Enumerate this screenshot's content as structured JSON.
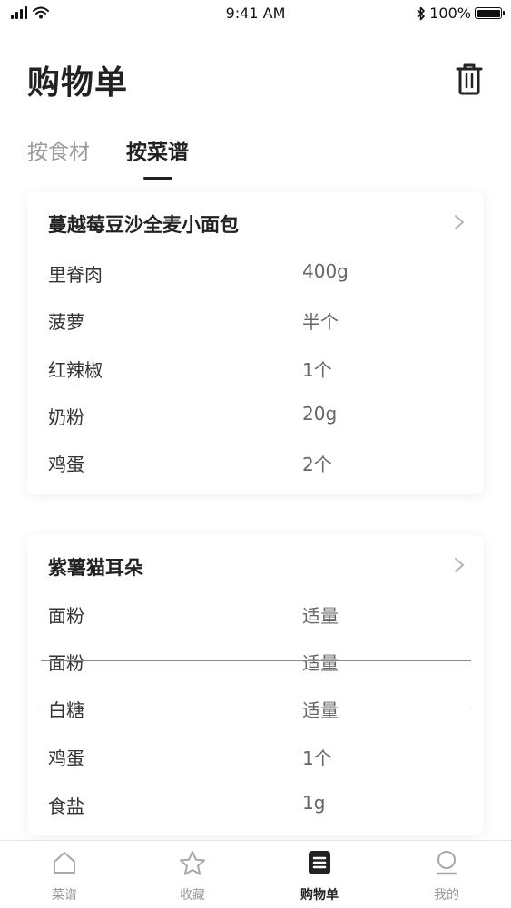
{
  "status_bar": {
    "time": "9:41 AM",
    "battery": "100%",
    "icons": [
      "signal-icon",
      "wifi-icon",
      "bluetooth-icon",
      "battery-icon"
    ]
  },
  "header": {
    "title": "购物单",
    "trash_icon": "trash-icon"
  },
  "tabs": [
    {
      "label": "按食材",
      "active": false
    },
    {
      "label": "按菜谱",
      "active": true
    }
  ],
  "recipes": [
    {
      "title": "蔓越莓豆沙全麦小面包",
      "chevron_icon": "chevron-right-icon",
      "ingredients": [
        {
          "name": "里脊肉",
          "qty": "400g",
          "struck": false
        },
        {
          "name": "菠萝",
          "qty": "半个",
          "struck": false
        },
        {
          "name": "红辣椒",
          "qty": "1个",
          "struck": false
        },
        {
          "name": "奶粉",
          "qty": "20g",
          "struck": false
        },
        {
          "name": "鸡蛋",
          "qty": "2个",
          "struck": false
        }
      ]
    },
    {
      "title": "紫薯猫耳朵",
      "chevron_icon": "chevron-right-icon",
      "ingredients": [
        {
          "name": "面粉",
          "qty": "适量",
          "struck": false
        },
        {
          "name": "面粉",
          "qty": "适量",
          "struck": true
        },
        {
          "name": "白糖",
          "qty": "适量",
          "struck": true
        },
        {
          "name": "鸡蛋",
          "qty": "1个",
          "struck": false
        },
        {
          "name": "食盐",
          "qty": "1g",
          "struck": false
        }
      ]
    }
  ],
  "tabbar": [
    {
      "label": "菜谱",
      "icon": "home-icon",
      "active": false
    },
    {
      "label": "收藏",
      "icon": "star-icon",
      "active": false
    },
    {
      "label": "购物单",
      "icon": "list-icon",
      "active": true
    },
    {
      "label": "我的",
      "icon": "profile-icon",
      "active": false
    }
  ],
  "colors": {
    "text_primary": "#222222",
    "text_secondary": "#9a9a9a",
    "strike": "#8a8a8a"
  }
}
